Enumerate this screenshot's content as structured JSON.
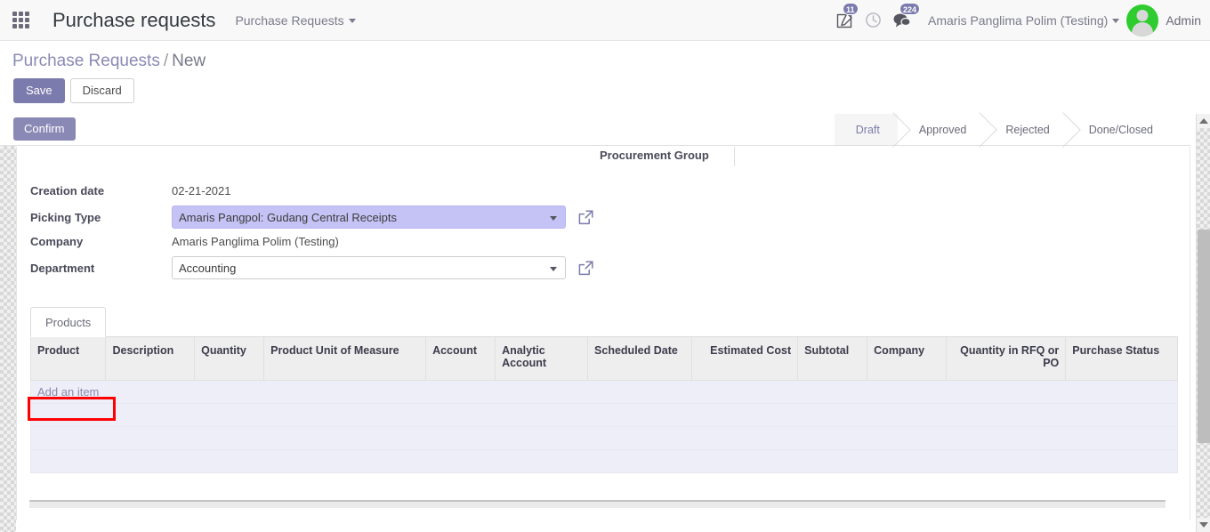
{
  "navbar": {
    "apps_icon": "apps-grid-icon",
    "title": "Purchase requests",
    "menu_label": "Purchase Requests",
    "icons": [
      {
        "name": "activity-edit-icon",
        "badge": "11"
      },
      {
        "name": "clock-icon",
        "badge": ""
      },
      {
        "name": "messages-icon",
        "badge": "224"
      }
    ],
    "user_label": "Amaris Panglima Polim (Testing)",
    "avatar_label": "Admin",
    "accent_color": "#7c7bad",
    "avatar_color": "#2ecc2e"
  },
  "breadcrumb": {
    "root": "Purchase Requests",
    "separator": "/",
    "current": "New"
  },
  "actions": {
    "save_label": "Save",
    "discard_label": "Discard"
  },
  "statusbar": {
    "confirm_label": "Confirm",
    "stages": [
      {
        "label": "Draft",
        "active": true
      },
      {
        "label": "Approved",
        "active": false
      },
      {
        "label": "Rejected",
        "active": false
      },
      {
        "label": "Done/Closed",
        "active": false
      }
    ]
  },
  "form": {
    "procurement_group_label": "Procurement Group",
    "fields": [
      {
        "label": "Creation date",
        "value": "02-21-2021",
        "type": "text"
      },
      {
        "label": "Picking Type",
        "value": "Amaris Pangpol: Gudang Central Receipts",
        "type": "select",
        "selected": true,
        "external_link": true
      },
      {
        "label": "Company",
        "value": "Amaris Panglima Polim (Testing)",
        "type": "text"
      },
      {
        "label": "Department",
        "value": "Accounting",
        "type": "select",
        "selected": false,
        "external_link": true
      }
    ],
    "selected_field_color": "#c5c3f5"
  },
  "notebook": {
    "tabs": [
      {
        "label": "Products",
        "active": true
      }
    ],
    "table": {
      "columns": [
        {
          "label": "Product",
          "align": "left"
        },
        {
          "label": "Description",
          "align": "left"
        },
        {
          "label": "Quantity",
          "align": "left"
        },
        {
          "label": "Product Unit of Measure",
          "align": "left"
        },
        {
          "label": "Account",
          "align": "left"
        },
        {
          "label": "Analytic Account",
          "align": "left"
        },
        {
          "label": "Scheduled Date",
          "align": "left"
        },
        {
          "label": "Estimated Cost",
          "align": "right"
        },
        {
          "label": "Subtotal",
          "align": "left"
        },
        {
          "label": "Company",
          "align": "left"
        },
        {
          "label": "Quantity in RFQ or PO",
          "align": "right"
        },
        {
          "label": "Purchase Status",
          "align": "left"
        }
      ],
      "rows": [],
      "add_item_label": "Add an item"
    }
  },
  "annotation": {
    "highlight_target": "add-item-link",
    "color": "#ff0000"
  }
}
